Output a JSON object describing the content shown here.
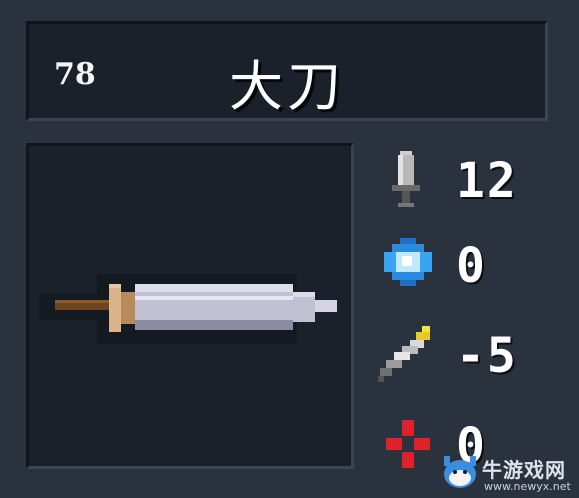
{
  "item": {
    "id": "78",
    "name": "大刀",
    "sprite": "broadsword-sprite"
  },
  "stats": [
    {
      "icon": "sword-damage-icon",
      "value": "12"
    },
    {
      "icon": "blue-crystal-energy-icon",
      "value": "0"
    },
    {
      "icon": "feather-quill-icon",
      "value": "-5"
    },
    {
      "icon": "red-crosshair-icon",
      "value": "0"
    }
  ],
  "colors": {
    "background": "#2a323e",
    "panel": "#1a212b",
    "text": "#ffffff",
    "crystal": "#7fd4ff",
    "crosshair": "#e0202a"
  },
  "watermark": {
    "name": "牛游戏网",
    "url": "www.newyx.net"
  }
}
